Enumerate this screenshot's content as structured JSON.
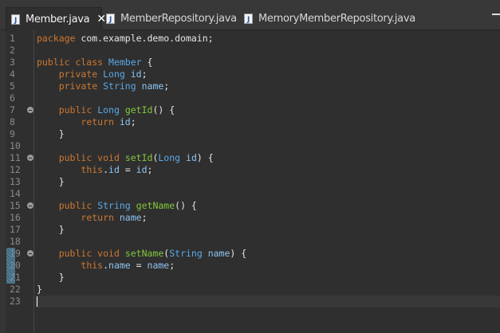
{
  "tabs": [
    {
      "label": "Member.java",
      "active": true,
      "closable": true,
      "icon": "java-file-icon"
    },
    {
      "label": "MemberRepository.java",
      "active": false,
      "closable": false,
      "icon": "java-file-icon"
    },
    {
      "label": "MemoryMemberRepository.java",
      "active": false,
      "closable": false,
      "icon": "java-file-icon"
    }
  ],
  "close_glyph": "✕",
  "editor": {
    "current_line": 23,
    "lines": [
      {
        "n": "1",
        "fold": false,
        "tokens": [
          [
            "kw",
            "package"
          ],
          [
            "txt",
            " com.example.demo.domain;"
          ]
        ]
      },
      {
        "n": "2",
        "fold": false,
        "tokens": []
      },
      {
        "n": "3",
        "fold": false,
        "tokens": [
          [
            "kw",
            "public class"
          ],
          [
            "txt",
            " "
          ],
          [
            "typ",
            "Member"
          ],
          [
            "txt",
            " {"
          ]
        ]
      },
      {
        "n": "4",
        "fold": false,
        "tokens": [
          [
            "txt",
            "    "
          ],
          [
            "kw",
            "private"
          ],
          [
            "txt",
            " "
          ],
          [
            "typ",
            "Long"
          ],
          [
            "txt",
            " "
          ],
          [
            "fld",
            "id"
          ],
          [
            "txt",
            ";"
          ]
        ]
      },
      {
        "n": "5",
        "fold": false,
        "tokens": [
          [
            "txt",
            "    "
          ],
          [
            "kw",
            "private"
          ],
          [
            "txt",
            " "
          ],
          [
            "typ",
            "String"
          ],
          [
            "txt",
            " "
          ],
          [
            "fld",
            "name"
          ],
          [
            "txt",
            ";"
          ]
        ]
      },
      {
        "n": "6",
        "fold": false,
        "tokens": []
      },
      {
        "n": "7",
        "fold": true,
        "tokens": [
          [
            "txt",
            "    "
          ],
          [
            "kw",
            "public"
          ],
          [
            "txt",
            " "
          ],
          [
            "typ",
            "Long"
          ],
          [
            "txt",
            " "
          ],
          [
            "fn",
            "getId"
          ],
          [
            "txt",
            "() {"
          ]
        ]
      },
      {
        "n": "8",
        "fold": false,
        "tokens": [
          [
            "txt",
            "        "
          ],
          [
            "kw",
            "return"
          ],
          [
            "txt",
            " "
          ],
          [
            "fld",
            "id"
          ],
          [
            "txt",
            ";"
          ]
        ]
      },
      {
        "n": "9",
        "fold": false,
        "tokens": [
          [
            "txt",
            "    }"
          ]
        ]
      },
      {
        "n": "10",
        "fold": false,
        "tokens": []
      },
      {
        "n": "11",
        "fold": true,
        "tokens": [
          [
            "txt",
            "    "
          ],
          [
            "kw",
            "public void"
          ],
          [
            "txt",
            " "
          ],
          [
            "fn",
            "setId"
          ],
          [
            "txt",
            "("
          ],
          [
            "typ",
            "Long"
          ],
          [
            "txt",
            " "
          ],
          [
            "fld",
            "id"
          ],
          [
            "txt",
            ") {"
          ]
        ]
      },
      {
        "n": "12",
        "fold": false,
        "tokens": [
          [
            "txt",
            "        "
          ],
          [
            "kw",
            "this"
          ],
          [
            "txt",
            "."
          ],
          [
            "fld",
            "id"
          ],
          [
            "txt",
            " = "
          ],
          [
            "fld",
            "id"
          ],
          [
            "txt",
            ";"
          ]
        ]
      },
      {
        "n": "13",
        "fold": false,
        "tokens": [
          [
            "txt",
            "    }"
          ]
        ]
      },
      {
        "n": "14",
        "fold": false,
        "tokens": []
      },
      {
        "n": "15",
        "fold": true,
        "tokens": [
          [
            "txt",
            "    "
          ],
          [
            "kw",
            "public"
          ],
          [
            "txt",
            " "
          ],
          [
            "typ",
            "String"
          ],
          [
            "txt",
            " "
          ],
          [
            "fn",
            "getName"
          ],
          [
            "txt",
            "() {"
          ]
        ]
      },
      {
        "n": "16",
        "fold": false,
        "tokens": [
          [
            "txt",
            "        "
          ],
          [
            "kw",
            "return"
          ],
          [
            "txt",
            " "
          ],
          [
            "fld",
            "name"
          ],
          [
            "txt",
            ";"
          ]
        ]
      },
      {
        "n": "17",
        "fold": false,
        "tokens": [
          [
            "txt",
            "    }"
          ]
        ]
      },
      {
        "n": "18",
        "fold": false,
        "tokens": []
      },
      {
        "n": "19",
        "fold": true,
        "tokens": [
          [
            "txt",
            "    "
          ],
          [
            "kw",
            "public void"
          ],
          [
            "txt",
            " "
          ],
          [
            "fn",
            "setName"
          ],
          [
            "txt",
            "("
          ],
          [
            "typ",
            "String"
          ],
          [
            "txt",
            " "
          ],
          [
            "fld",
            "name"
          ],
          [
            "txt",
            ") {"
          ]
        ]
      },
      {
        "n": "20",
        "fold": false,
        "tokens": [
          [
            "txt",
            "        "
          ],
          [
            "kw",
            "this"
          ],
          [
            "txt",
            "."
          ],
          [
            "fld",
            "name"
          ],
          [
            "txt",
            " = "
          ],
          [
            "fld",
            "name"
          ],
          [
            "txt",
            ";"
          ]
        ]
      },
      {
        "n": "21",
        "fold": false,
        "tokens": [
          [
            "txt",
            "    }"
          ]
        ]
      },
      {
        "n": "22",
        "fold": false,
        "tokens": [
          [
            "txt",
            "}"
          ]
        ]
      },
      {
        "n": "23",
        "fold": false,
        "tokens": []
      }
    ]
  }
}
